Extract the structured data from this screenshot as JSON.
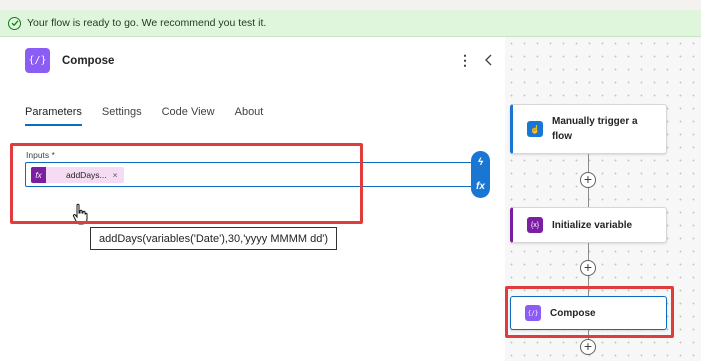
{
  "banner": {
    "message": "Your flow is ready to go. We recommend you test it.",
    "icon": "checkmark-circle-icon"
  },
  "panel": {
    "title": "Compose",
    "compose_icon_glyph": "{/}",
    "more_glyph": "⋮",
    "tabs": [
      {
        "label": "Parameters",
        "active": true
      },
      {
        "label": "Settings",
        "active": false
      },
      {
        "label": "Code View",
        "active": false
      },
      {
        "label": "About",
        "active": false
      }
    ],
    "inputs": {
      "label": "Inputs *",
      "token": {
        "icon_glyph": "fx",
        "text": "addDays...",
        "remove_glyph": "×"
      }
    },
    "tooltip": "addDays(variables('Date'),30,'yyyy MMMM dd')",
    "side_buttons": {
      "dynamic_content_glyph": "ϟ",
      "expression_glyph": "fx"
    }
  },
  "canvas": {
    "cards": [
      {
        "label": "Manually trigger a flow",
        "icon": "hand-touch-icon",
        "icon_color": "#1976d2",
        "icon_glyph": "☝"
      },
      {
        "label": "Initialize variable",
        "icon": "variable-icon",
        "icon_color": "#7b1fa2",
        "icon_glyph": "{x}"
      },
      {
        "label": "Compose",
        "icon": "compose-icon",
        "icon_color": "#8b5cf6",
        "icon_glyph": "{/}"
      }
    ],
    "plus_glyph": "+"
  },
  "colors": {
    "accent": "#0f6cbd",
    "highlight_red": "#e03c3c",
    "banner_bg": "#dff6dd"
  }
}
